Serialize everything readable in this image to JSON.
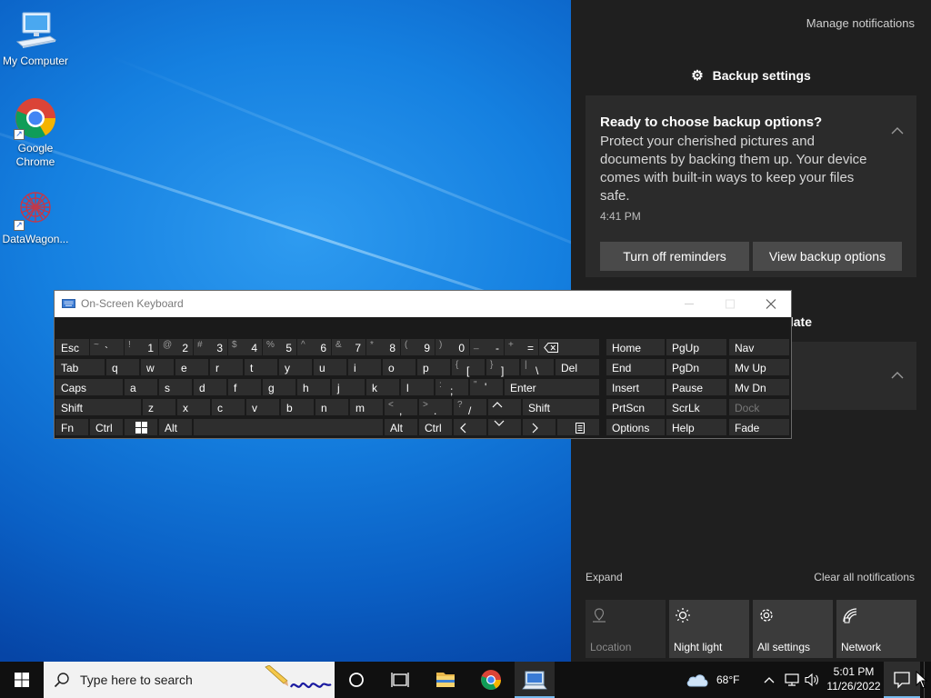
{
  "desktop": {
    "icons": [
      {
        "label": "My Computer"
      },
      {
        "label": "Google Chrome"
      },
      {
        "label": "DataWagon..."
      }
    ]
  },
  "action_center": {
    "manage_notifications": "Manage notifications",
    "group1_title": "Backup settings",
    "notification": {
      "title": "Ready to choose backup options?",
      "body": "Protect your cherished pictures and documents by backing them up. Your device comes with built-in ways to keep your files safe.",
      "time": "4:41 PM",
      "buttons": [
        "Turn off reminders",
        "View backup options"
      ]
    },
    "group2_title_visible": "late",
    "expand": "Expand",
    "clear_all": "Clear all notifications",
    "quick_actions": [
      {
        "label": "Location",
        "icon": "location-icon",
        "enabled": false
      },
      {
        "label": "Night light",
        "icon": "night-light-icon",
        "enabled": true
      },
      {
        "label": "All settings",
        "icon": "settings-gear-icon",
        "enabled": true
      },
      {
        "label": "Network",
        "icon": "network-icon",
        "enabled": true
      }
    ]
  },
  "osk": {
    "title": "On-Screen Keyboard",
    "keys": {
      "esc": "Esc",
      "backtick": {
        "shift": "~",
        "main": "`"
      },
      "n1": {
        "shift": "!",
        "main": "1"
      },
      "n2": {
        "shift": "@",
        "main": "2"
      },
      "n3": {
        "shift": "#",
        "main": "3"
      },
      "n4": {
        "shift": "$",
        "main": "4"
      },
      "n5": {
        "shift": "%",
        "main": "5"
      },
      "n6": {
        "shift": "^",
        "main": "6"
      },
      "n7": {
        "shift": "&",
        "main": "7"
      },
      "n8": {
        "shift": "*",
        "main": "8"
      },
      "n9": {
        "shift": "(",
        "main": "9"
      },
      "n0": {
        "shift": ")",
        "main": "0"
      },
      "minus": {
        "shift": "_",
        "main": "-"
      },
      "equals": {
        "shift": "+",
        "main": "="
      },
      "tab": "Tab",
      "q": "q",
      "w": "w",
      "e": "e",
      "r": "r",
      "t": "t",
      "y": "y",
      "u": "u",
      "i": "i",
      "o": "o",
      "p": "p",
      "lbracket": {
        "shift": "{",
        "main": "["
      },
      "rbracket": {
        "shift": "}",
        "main": "]"
      },
      "backslash": {
        "shift": "|",
        "main": "\\"
      },
      "del": "Del",
      "caps": "Caps",
      "a": "a",
      "s": "s",
      "d": "d",
      "f": "f",
      "g": "g",
      "h": "h",
      "j": "j",
      "k": "k",
      "l": "l",
      "semicolon": {
        "shift": ":",
        "main": ";"
      },
      "quote": {
        "shift": "\"",
        "main": "'"
      },
      "enter": "Enter",
      "shift_l": "Shift",
      "z": "z",
      "x": "x",
      "c": "c",
      "v": "v",
      "b": "b",
      "n": "n",
      "m": "m",
      "comma": {
        "shift": "<",
        "main": ","
      },
      "period": {
        "shift": ">",
        "main": "."
      },
      "slash": {
        "shift": "?",
        "main": "/"
      },
      "shift_r": "Shift",
      "fn": "Fn",
      "ctrl_l": "Ctrl",
      "alt_l": "Alt",
      "alt_r": "Alt",
      "ctrl_r": "Ctrl",
      "home": "Home",
      "pgup": "PgUp",
      "nav": "Nav",
      "end": "End",
      "pgdn": "PgDn",
      "mvup": "Mv Up",
      "insert": "Insert",
      "pause": "Pause",
      "mvdn": "Mv Dn",
      "prtscn": "PrtScn",
      "scrlk": "ScrLk",
      "dock": "Dock",
      "options": "Options",
      "help": "Help",
      "fade": "Fade"
    }
  },
  "taskbar": {
    "search_placeholder": "Type here to search",
    "weather": "68°F",
    "time": "5:01 PM",
    "date": "11/26/2022"
  },
  "colors": {
    "desktop_blue": "#1580e0",
    "panel_bg": "#1f1f1f",
    "card_bg": "#2b2b2b",
    "taskbar_bg": "#101010"
  }
}
